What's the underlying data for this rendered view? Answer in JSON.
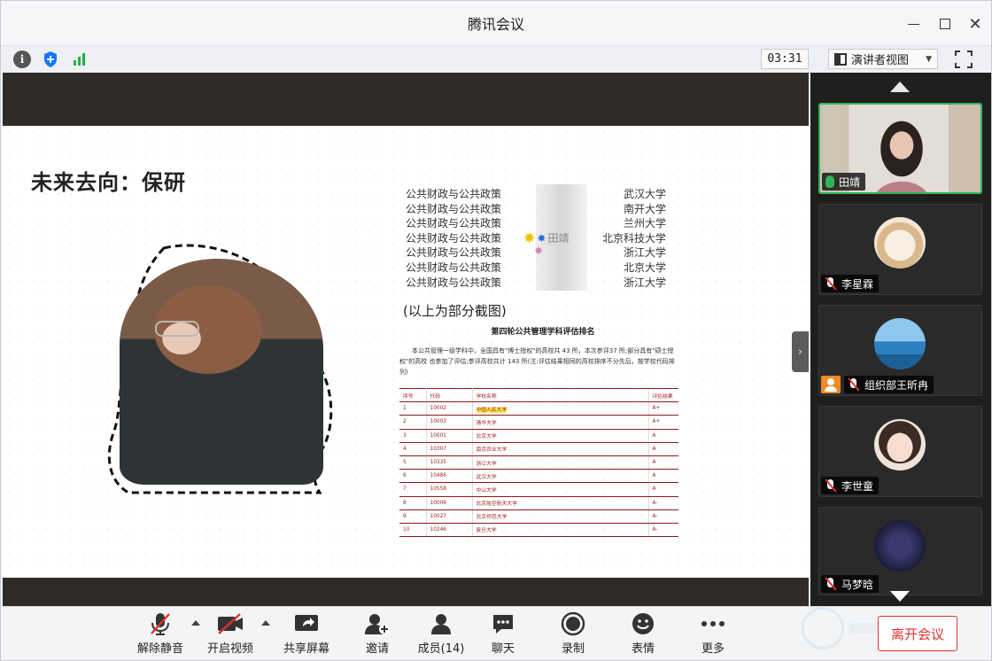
{
  "window": {
    "title": "腾讯会议"
  },
  "status": {
    "timer": "03:31",
    "view_mode": "演讲者视图"
  },
  "slide": {
    "title": "未来去向：保研",
    "school_list": [
      {
        "discipline": "公共财政与公共政策",
        "school": "武汉大学"
      },
      {
        "discipline": "公共财政与公共政策",
        "school": "南开大学"
      },
      {
        "discipline": "公共财政与公共政策",
        "school": "兰州大学"
      },
      {
        "discipline": "公共财政与公共政策",
        "school": "北京科技大学"
      },
      {
        "discipline": "公共财政与公共政策",
        "school": "浙江大学"
      },
      {
        "discipline": "公共财政与公共政策",
        "school": "北京大学"
      },
      {
        "discipline": "公共财政与公共政策",
        "school": "浙江大学"
      }
    ],
    "overlay_name": "田靖",
    "caption": "(以上为部分截图)",
    "ranking_title": "第四轮公共管理学科评估排名",
    "ranking_desc": "本公共管理一级学科中，全国具有\"博士授权\"的高校共 43 所，本次参评37 所;部分具有\"硕士授权\"的高校 也参加了评估;参评高校共计 143 所(注:评估结果相同的高校排序不分先后，按学校代码排列)",
    "ranking_headers": [
      "序号",
      "代码",
      "学校名称",
      "评估结果"
    ],
    "ranking_rows": [
      {
        "no": "1",
        "code": "10002",
        "name": "中国人民大学",
        "result": "A+",
        "highlight": true
      },
      {
        "no": "2",
        "code": "10003",
        "name": "清华大学",
        "result": "A+"
      },
      {
        "no": "3",
        "code": "10001",
        "name": "北京大学",
        "result": "A"
      },
      {
        "no": "4",
        "code": "10307",
        "name": "南京农业大学",
        "result": "A"
      },
      {
        "no": "5",
        "code": "10335",
        "name": "浙江大学",
        "result": "A"
      },
      {
        "no": "6",
        "code": "10486",
        "name": "武汉大学",
        "result": "A"
      },
      {
        "no": "7",
        "code": "10558",
        "name": "中山大学",
        "result": "A"
      },
      {
        "no": "8",
        "code": "10006",
        "name": "北京航空航天大学",
        "result": "A-"
      },
      {
        "no": "9",
        "code": "10027",
        "name": "北京师范大学",
        "result": "A-"
      },
      {
        "no": "10",
        "code": "10246",
        "name": "复旦大学",
        "result": "A-"
      }
    ]
  },
  "participants": [
    {
      "name": "田靖",
      "mic": "on",
      "video": true
    },
    {
      "name": "李星霖",
      "mic": "off",
      "avatar_color": "#f3e7d4"
    },
    {
      "name": "组织部王昕冉",
      "mic": "off",
      "avatar_color": "#3f8fd0",
      "host": true
    },
    {
      "name": "李世童",
      "mic": "off",
      "avatar_color": "#efe3d8"
    },
    {
      "name": "马梦晗",
      "mic": "off",
      "avatar_color": "#1b1c3a"
    }
  ],
  "toolbar": {
    "mute_label": "解除静音",
    "video_label": "开启视频",
    "share_label": "共享屏幕",
    "invite_label": "邀请",
    "members_label": "成员(14)",
    "chat_label": "聊天",
    "record_label": "录制",
    "reaction_label": "表情",
    "more_label": "更多",
    "leave_label": "离开会议"
  },
  "colors": {
    "accent_red": "#e0312f",
    "accent_green": "#2fb55a",
    "shield_blue": "#1677ff"
  }
}
